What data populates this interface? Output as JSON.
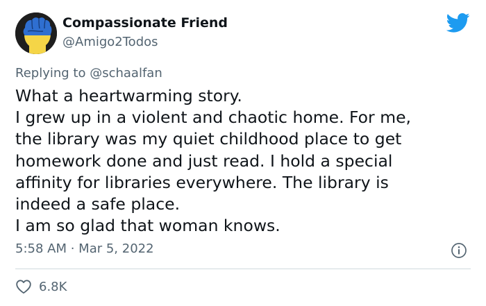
{
  "author": {
    "name": "Compassionate Friend",
    "handle": "@Amigo2Todos"
  },
  "reply": {
    "prefix": "Replying to ",
    "mention": "@schaalfan"
  },
  "tweet": {
    "lines": [
      "What a heartwarming story.",
      "I grew up in a violent and chaotic home. For me,",
      "the library was my quiet childhood place to get",
      "homework done and just read. I hold a special",
      "affinity for libraries everywhere. The library is",
      "indeed a safe place.",
      "I am so glad that woman knows."
    ]
  },
  "meta": {
    "time": "5:58 AM",
    "separator": " · ",
    "date": "Mar 5, 2022"
  },
  "engagement": {
    "likes": "6.8K"
  },
  "icons": {
    "brand": "twitter-bird-icon",
    "info": "info-icon",
    "like": "heart-icon"
  },
  "colors": {
    "brand": "#1d9bf0",
    "text": "#0f1419",
    "secondary": "#536471",
    "divider": "#cfd9de",
    "avatar_blue": "#2f6fd1",
    "avatar_yellow": "#f5d547"
  }
}
